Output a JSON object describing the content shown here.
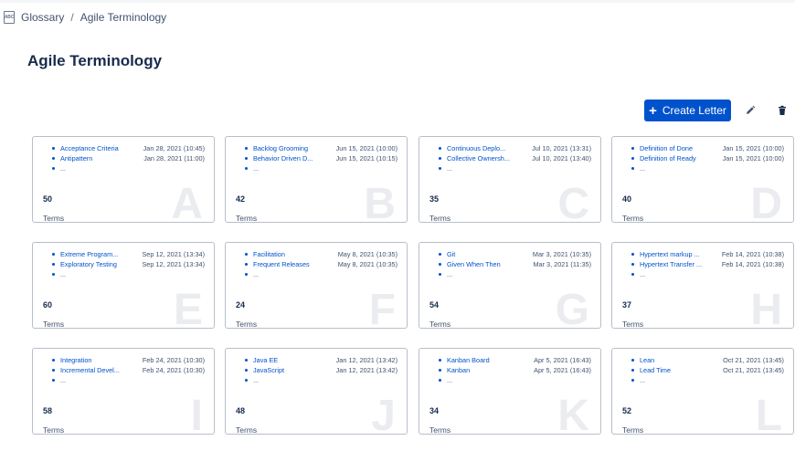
{
  "breadcrumb": {
    "icon_text": "ABC",
    "parent": "Glossary",
    "separator": "/",
    "current": "Agile Terminology"
  },
  "page": {
    "title": "Agile Terminology"
  },
  "toolbar": {
    "create_label": "Create Letter",
    "create_icon": "plus-icon",
    "edit_icon": "pencil-icon",
    "delete_icon": "trash-icon"
  },
  "terms_label": "Terms",
  "more_marker": "...",
  "cards": [
    {
      "letter": "A",
      "count": "50",
      "terms": [
        {
          "name": "Acceptance Criteria",
          "date": "Jan 28, 2021 (10:45)"
        },
        {
          "name": "Antipattern",
          "date": "Jan 28, 2021 (11:00)"
        }
      ]
    },
    {
      "letter": "B",
      "count": "42",
      "terms": [
        {
          "name": "Backlog Grooming",
          "date": "Jun 15, 2021 (10:00)"
        },
        {
          "name": "Behavior Driven D...",
          "date": "Jun 15, 2021 (10:15)"
        }
      ]
    },
    {
      "letter": "C",
      "count": "35",
      "terms": [
        {
          "name": "Continuous Deplo...",
          "date": "Jul 10, 2021 (13:31)"
        },
        {
          "name": "Collective Ownersh...",
          "date": "Jul 10, 2021 (13:40)"
        }
      ]
    },
    {
      "letter": "D",
      "count": "40",
      "terms": [
        {
          "name": "Definition of Done",
          "date": "Jan 15, 2021 (10:00)"
        },
        {
          "name": "Definition of Ready",
          "date": "Jan 15, 2021 (10:00)"
        }
      ]
    },
    {
      "letter": "E",
      "count": "60",
      "terms": [
        {
          "name": "Extreme Program...",
          "date": "Sep 12, 2021 (13:34)"
        },
        {
          "name": "Exploratory Testing",
          "date": "Sep 12, 2021 (13:34)"
        }
      ]
    },
    {
      "letter": "F",
      "count": "24",
      "terms": [
        {
          "name": "Facilitation",
          "date": "May 8, 2021 (10:35)"
        },
        {
          "name": "Frequent Releases",
          "date": "May 8, 2021 (10:35)"
        }
      ]
    },
    {
      "letter": "G",
      "count": "54",
      "terms": [
        {
          "name": "Git",
          "date": "Mar 3, 2021 (10:35)"
        },
        {
          "name": "Given When Then",
          "date": "Mar 3, 2021 (11:35)"
        }
      ]
    },
    {
      "letter": "H",
      "count": "37",
      "terms": [
        {
          "name": "Hypertext markup ...",
          "date": "Feb 14, 2021 (10:38)"
        },
        {
          "name": "Hypertext Transfer ...",
          "date": "Feb 14, 2021 (10:38)"
        }
      ]
    },
    {
      "letter": "I",
      "count": "58",
      "terms": [
        {
          "name": "Integration",
          "date": "Feb 24, 2021 (10:30)"
        },
        {
          "name": "Incremental Devel...",
          "date": "Feb 24, 2021 (10:30)"
        }
      ]
    },
    {
      "letter": "J",
      "count": "48",
      "terms": [
        {
          "name": "Java EE",
          "date": "Jan 12, 2021 (13:42)"
        },
        {
          "name": "JavaScript",
          "date": "Jan 12, 2021 (13:42)"
        }
      ]
    },
    {
      "letter": "K",
      "count": "34",
      "terms": [
        {
          "name": "Kanban Board",
          "date": "Apr 5, 2021 (16:43)"
        },
        {
          "name": "Kanban",
          "date": "Apr 5, 2021 (16:43)"
        }
      ]
    },
    {
      "letter": "L",
      "count": "52",
      "terms": [
        {
          "name": "Lean",
          "date": "Oct 21, 2021 (13:45)"
        },
        {
          "name": "Lead Time",
          "date": "Oct 21, 2021 (13:45)"
        }
      ]
    }
  ]
}
